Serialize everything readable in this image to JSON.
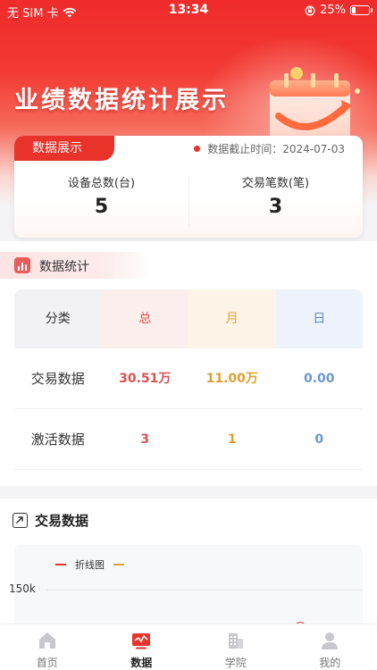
{
  "status_bar": {
    "carrier": "无 SIM 卡",
    "time": "13:34",
    "battery": "25%",
    "battery_level": 0.25
  },
  "hero": {
    "title": "业绩数据统计展示"
  },
  "summary": {
    "tab_label": "数据展示",
    "deadline": "数据截止时间：2024-07-03",
    "stats": [
      {
        "label": "设备总数(台)",
        "value": "5"
      },
      {
        "label": "交易笔数(笔)",
        "value": "3"
      }
    ]
  },
  "stats": {
    "section_title": "数据统计",
    "columns": [
      "分类",
      "总",
      "月",
      "日"
    ],
    "rows": [
      {
        "name": "交易数据",
        "total": "30.51万",
        "month": "11.00万",
        "day": "0.00"
      },
      {
        "name": "激活数据",
        "total": "3",
        "month": "1",
        "day": "0"
      }
    ]
  },
  "chart": {
    "section_title": "交易数据",
    "legend": "折线图",
    "y_tick": "150k"
  },
  "chart_data": {
    "type": "line",
    "title": "折线图",
    "y_ticks": [
      "150k"
    ]
  },
  "tabbar": {
    "items": [
      {
        "label": "首页",
        "icon": "home-icon",
        "active": false
      },
      {
        "label": "数据",
        "icon": "chart-icon",
        "active": true
      },
      {
        "label": "学院",
        "icon": "building-icon",
        "active": false
      },
      {
        "label": "我的",
        "icon": "user-icon",
        "active": false
      }
    ]
  },
  "colors": {
    "primary_red": "#e8322a",
    "total": "#d9534f",
    "month": "#e0a030",
    "day": "#6a97d2"
  }
}
